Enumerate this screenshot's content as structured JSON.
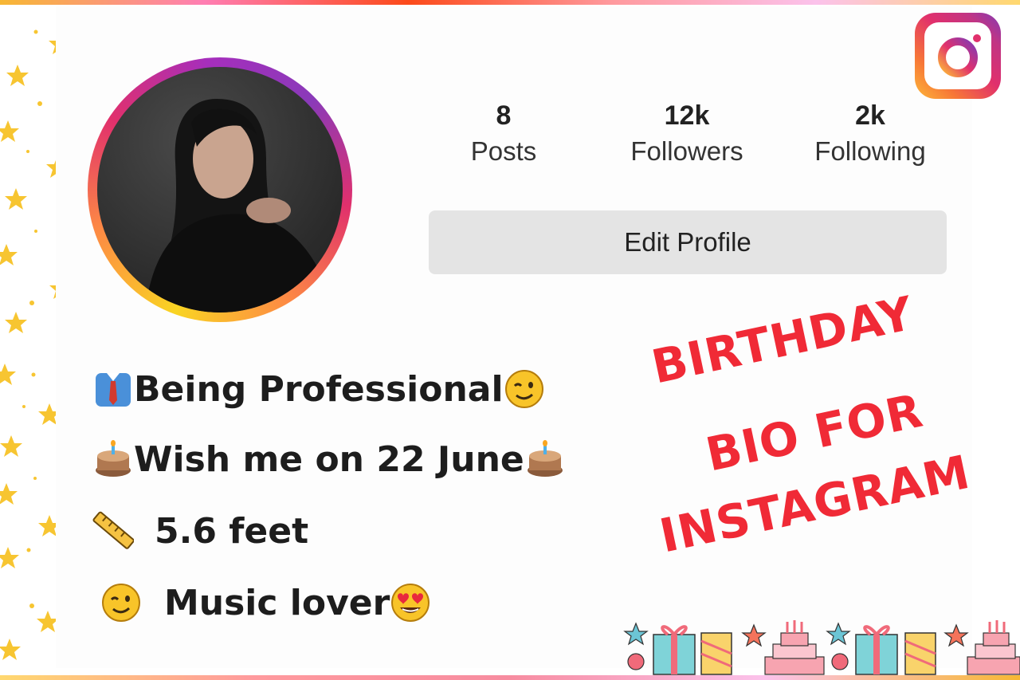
{
  "profile": {
    "stats": [
      {
        "value": "8",
        "label": "Posts"
      },
      {
        "value": "12k",
        "label": "Followers"
      },
      {
        "value": "2k",
        "label": "Following"
      }
    ],
    "edit_button_label": "Edit Profile"
  },
  "bio": {
    "line1": {
      "icon": "necktie-shirt-icon",
      "text": "Being Professional",
      "trailing_icon": "wink-face-icon"
    },
    "line2": {
      "icon": "birthday-cake-icon",
      "text": "Wish me on 22 June",
      "trailing_icon": "birthday-cake-icon"
    },
    "line3": {
      "icon": "ruler-icon",
      "text": "5.6 feet"
    },
    "line4": {
      "icon": "wink-face-icon",
      "text": "Music lover",
      "trailing_icon": "heart-eyes-face-icon"
    }
  },
  "headline": {
    "line1": "BIRTHDAY",
    "line2": "BIO FOR",
    "line3": "INSTAGRAM",
    "color": "#f02a36"
  },
  "brand": {
    "logo_icon": "instagram-logo-icon"
  }
}
